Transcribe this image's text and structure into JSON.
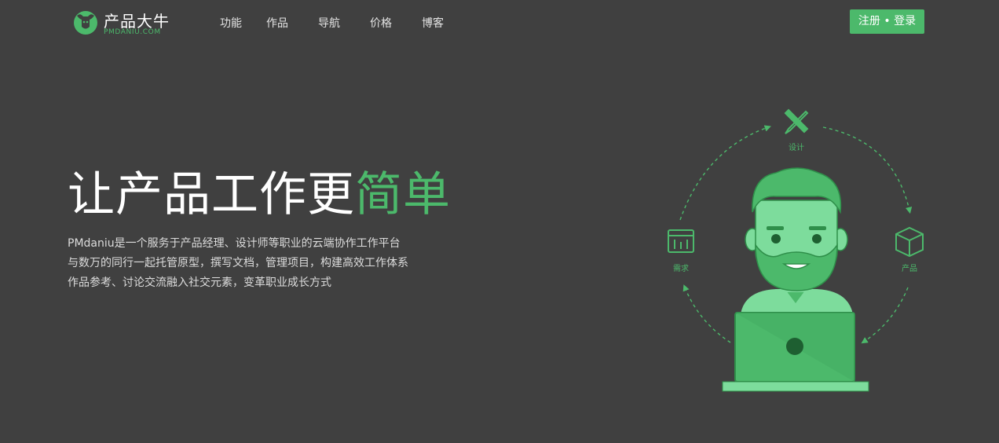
{
  "header": {
    "logo": {
      "name": "产品大牛",
      "subtitle": "PMDANIU.COM"
    },
    "nav": [
      {
        "label": "功能"
      },
      {
        "label": "作品"
      },
      {
        "label": "导航"
      },
      {
        "label": "价格"
      },
      {
        "label": "博客"
      }
    ],
    "auth_label": "注册 • 登录"
  },
  "hero": {
    "title_main": "让产品工作更",
    "title_accent": "简单",
    "description": [
      "PMdaniu是一个服务于产品经理、设计师等职业的云端协作工作平台",
      "与数万的同行一起托管原型，撰写文档，管理项目，构建高效工作体系",
      "作品参考、讨论交流融入社交元素，变革职业成长方式"
    ]
  },
  "illustration": {
    "labels": {
      "design": "设计",
      "requirement": "需求",
      "product": "产品"
    }
  },
  "colors": {
    "background": "#404040",
    "accent": "#4cb96b",
    "accent_light": "#7ddc9c"
  }
}
